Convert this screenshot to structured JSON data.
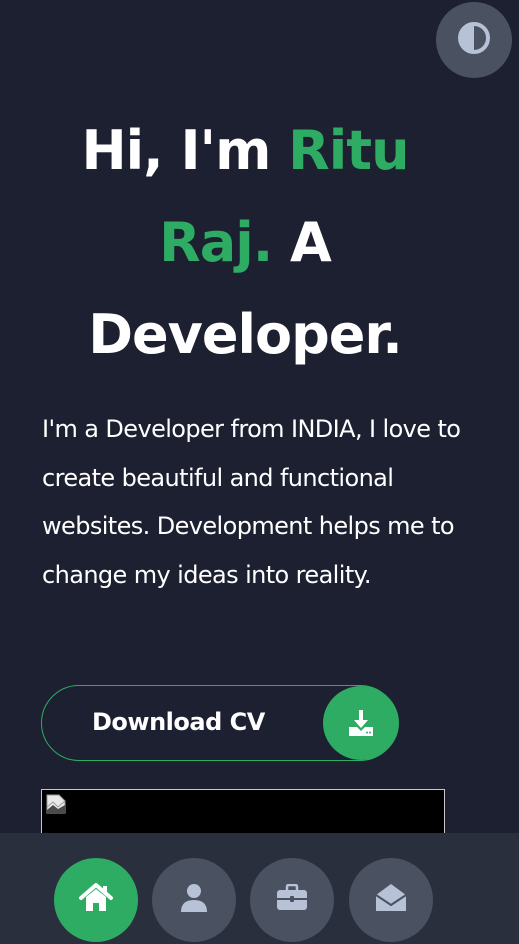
{
  "hero": {
    "line1_prefix": "Hi, I'm ",
    "name_part1": "Ritu",
    "name_part2": "Raj.",
    "line2_suffix": " A",
    "line3": "Developer."
  },
  "intro": {
    "text": "I'm a Developer from INDIA, I love to create beautiful and functional websites. Development helps me to change my ideas into reality."
  },
  "cv_button": {
    "label": "Download CV",
    "icon": "download-icon"
  },
  "theme_toggle": {
    "icon": "contrast-icon"
  },
  "bottom_nav": {
    "items": [
      {
        "icon": "home-icon",
        "active": true
      },
      {
        "icon": "user-icon",
        "active": false
      },
      {
        "icon": "briefcase-icon",
        "active": false
      },
      {
        "icon": "envelope-open-icon",
        "active": false
      }
    ]
  },
  "colors": {
    "background": "#1c2030",
    "accent": "#2eac63",
    "button_gray": "#4a5160",
    "nav_bar": "#2a2f3d",
    "icon_light": "#b8c2d6"
  }
}
